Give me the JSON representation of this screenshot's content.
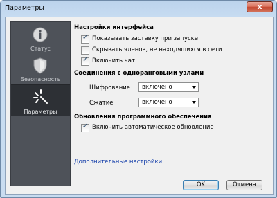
{
  "window": {
    "title": "Параметры",
    "close_symbol": "x"
  },
  "sidebar": {
    "items": [
      {
        "label": "Статус",
        "icon": "info-icon",
        "active": false
      },
      {
        "label": "Безопасность",
        "icon": "shield-icon",
        "active": false
      },
      {
        "label": "Параметры",
        "icon": "settings-sparkle-icon",
        "active": true
      }
    ]
  },
  "interface": {
    "title": "Настройки интерфейса",
    "options": [
      {
        "label": "Показывать заставку при запуске",
        "checked": true
      },
      {
        "label": "Скрывать членов, не находящихся в сети",
        "checked": false
      },
      {
        "label": "Включить чат",
        "checked": true
      }
    ]
  },
  "peer": {
    "title": "Соединения с одноранговыми узлами",
    "encryption_label": "Шифрование",
    "encryption_value": "включено",
    "compression_label": "Сжатие",
    "compression_value": "включено"
  },
  "updates": {
    "title": "Обновления программного обеспечения",
    "auto_update_label": "Включить автоматическое обновление",
    "auto_update_checked": true
  },
  "advanced_link": "Дополнительные настройки",
  "buttons": {
    "ok": "OK",
    "cancel": "Отмена"
  }
}
